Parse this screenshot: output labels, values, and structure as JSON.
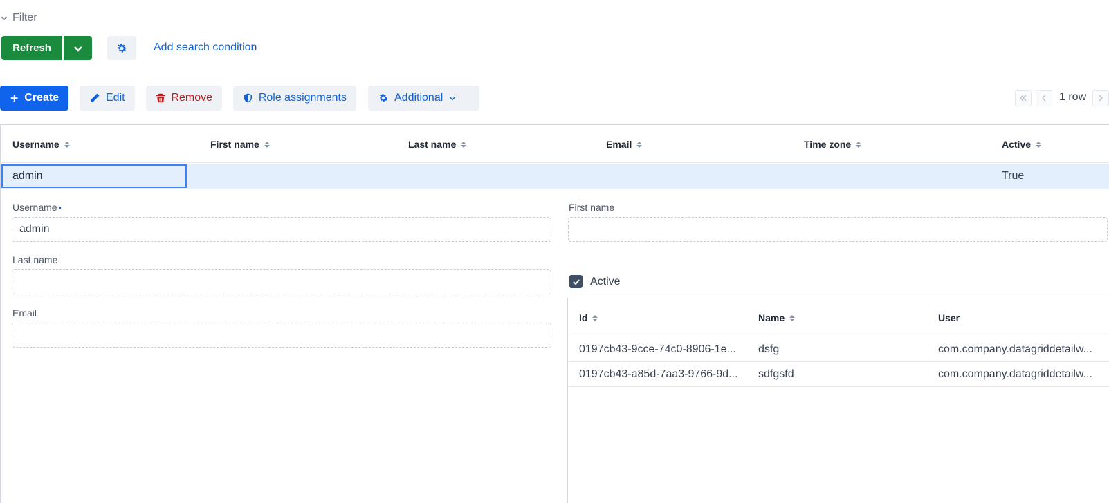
{
  "filter": {
    "label": "Filter"
  },
  "actions": {
    "refresh_label": "Refresh",
    "add_condition_label": "Add search condition"
  },
  "toolbar": {
    "create_label": "Create",
    "edit_label": "Edit",
    "remove_label": "Remove",
    "roles_label": "Role assignments",
    "additional_label": "Additional"
  },
  "pager": {
    "count_label": "1 row"
  },
  "grid": {
    "columns": [
      "Username",
      "First name",
      "Last name",
      "Email",
      "Time zone",
      "Active"
    ],
    "rows": [
      {
        "username": "admin",
        "first_name": "",
        "last_name": "",
        "email": "",
        "time_zone": "",
        "active": "True"
      }
    ]
  },
  "form": {
    "username_label": "Username",
    "username_value": "admin",
    "first_name_label": "First name",
    "first_name_value": "",
    "last_name_label": "Last name",
    "last_name_value": "",
    "email_label": "Email",
    "email_value": "",
    "active_label": "Active",
    "active_checked": true
  },
  "sub_grid": {
    "columns": [
      "Id",
      "Name",
      "User"
    ],
    "rows": [
      {
        "id": "0197cb43-9cce-74c0-8906-1e...",
        "name": "dsfg",
        "user": "com.company.datagriddetailw..."
      },
      {
        "id": "0197cb43-a85d-7aa3-9766-9d...",
        "name": "sdfgsfd",
        "user": "com.company.datagriddetailw..."
      }
    ]
  },
  "colors": {
    "primary": "#1063eb",
    "success": "#1a8a3d",
    "danger": "#b91c1c",
    "selected_row": "#e3effc"
  },
  "icons": {
    "filter_toggle": "chevron-down-icon",
    "refresh_menu": "chevron-down-icon",
    "settings": "gear-icon",
    "create": "plus-icon",
    "edit": "pencil-icon",
    "remove": "trash-icon",
    "roles": "shield-icon",
    "additional": "gear-icon"
  }
}
